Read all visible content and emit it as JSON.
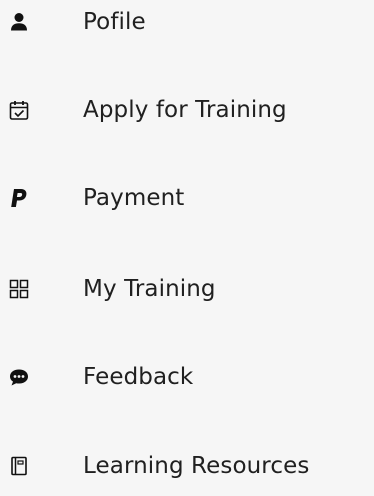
{
  "menu": {
    "items": [
      {
        "label": "Pofile",
        "icon": "user-icon"
      },
      {
        "label": "Apply for Training",
        "icon": "calendar-check-icon"
      },
      {
        "label": "Payment",
        "icon": "paypal-icon"
      },
      {
        "label": "My Training",
        "icon": "grid-icon"
      },
      {
        "label": "Feedback",
        "icon": "comment-dots-icon"
      },
      {
        "label": "Learning Resources",
        "icon": "book-icon"
      }
    ]
  }
}
